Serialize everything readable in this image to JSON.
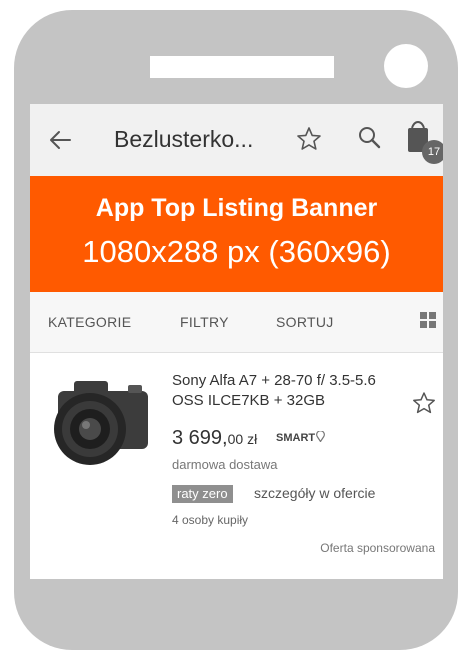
{
  "header": {
    "title": "Bezlusterko...",
    "cart_count": "17",
    "icons": [
      "back-arrow-icon",
      "star-icon",
      "search-icon",
      "shopping-bag-icon"
    ]
  },
  "banner": {
    "title": "App Top Listing Banner",
    "subtitle": "1080x288 px (360x96)",
    "color": "#ff5a00"
  },
  "tabs": [
    {
      "label": "KATEGORIE"
    },
    {
      "label": "FILTRY"
    },
    {
      "label": "SORTUJ"
    }
  ],
  "product": {
    "title": "Sony Alfa A7 + 28-70 f/ 3.5-5.6 OSS ILCE7KB + 32GB",
    "price_main": "3 699,",
    "price_cents": "00 zł",
    "smart_label": "SMART",
    "shipping": "darmowa dostawa",
    "raty_badge": "raty zero",
    "details_link": "szczegóły w ofercie",
    "buyers": "4 osoby kupiły",
    "sponsored": "Oferta sponsorowana"
  }
}
